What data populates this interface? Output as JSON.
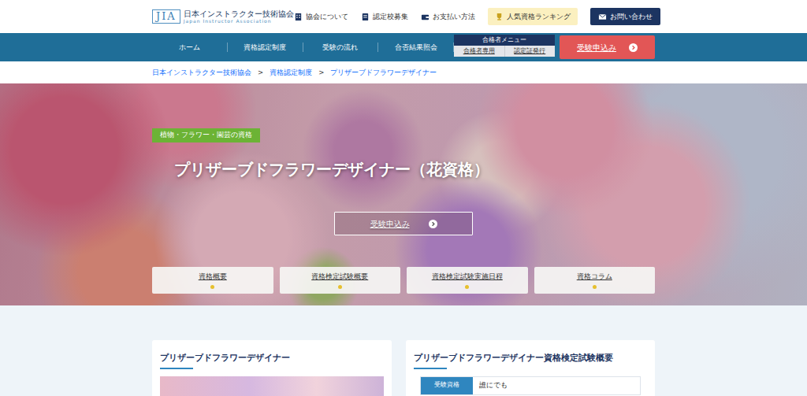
{
  "header": {
    "logo": {
      "mark": "JIA",
      "name": "日本インストラクター技術協会",
      "name_en": "Japan Instructor Association"
    },
    "links": [
      {
        "label": "協会について",
        "kind": "about"
      },
      {
        "label": "認定校募集",
        "kind": "recruit"
      },
      {
        "label": "お支払い方法",
        "kind": "payment"
      },
      {
        "label": "人気資格ランキング",
        "kind": "ranking"
      },
      {
        "label": "お問い合わせ",
        "kind": "contact"
      }
    ]
  },
  "nav": {
    "items": [
      {
        "label": "ホーム",
        "selected": false
      },
      {
        "label": "資格認定制度",
        "selected": false
      },
      {
        "label": "受験の流れ",
        "selected": false
      },
      {
        "label": "合否結果照会",
        "selected": false
      }
    ],
    "member_menu": {
      "title": "合格者メニュー",
      "items": [
        "合格者専用",
        "認定証発行"
      ]
    },
    "apply": "受験申込み"
  },
  "breadcrumb": {
    "separator": ">",
    "items": [
      "日本インストラクター技術協会",
      "資格認定制度",
      "プリザーブドフラワーデザイナー"
    ]
  },
  "hero": {
    "category": "植物・フラワー・園芸の資格",
    "title": "プリザーブドフラワーデザイナー（花資格）",
    "apply": "受験申込み",
    "tabs": [
      "資格概要",
      "資格検定試験概要",
      "資格検定試験実施日程",
      "資格コラム"
    ]
  },
  "sections": {
    "intro": {
      "title": "プリザーブドフラワーデザイナー"
    },
    "exam": {
      "title": "プリザーブドフラワーデザイナー資格検定試験概要",
      "rows": [
        {
          "label": "受験資格",
          "value": "誰にでも"
        }
      ]
    }
  }
}
